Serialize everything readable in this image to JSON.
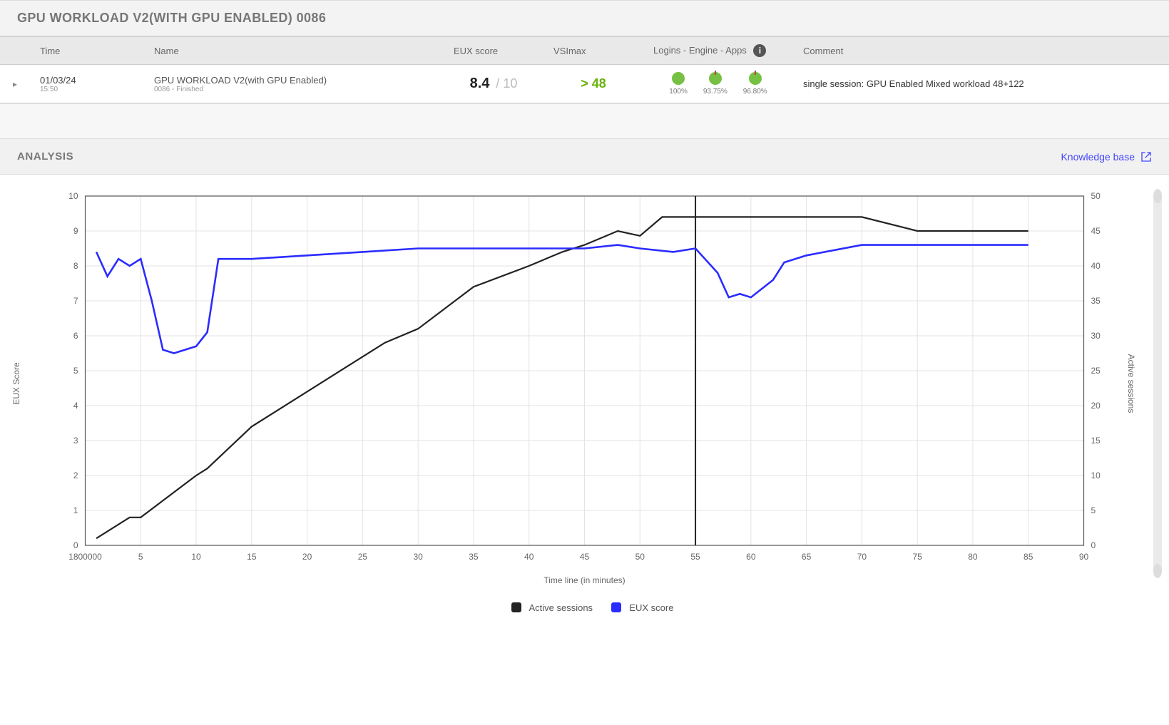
{
  "header": {
    "title": "GPU WORKLOAD V2(WITH GPU ENABLED) 0086"
  },
  "table": {
    "cols": {
      "time": "Time",
      "name": "Name",
      "eux": "EUX score",
      "vsi": "VSImax",
      "lea": "Logins - Engine - Apps",
      "comment": "Comment"
    },
    "row": {
      "date": "01/03/24",
      "time": "15:50",
      "run_name": "GPU WORKLOAD V2(with GPU Enabled)",
      "run_sub": "0086 - Finished",
      "eux_value": "8.4",
      "eux_max": " / 10",
      "vsimax": "> 48",
      "logins_pct": "100%",
      "engine_pct": "93.75%",
      "apps_pct": "96.80%",
      "comment": "single session: GPU Enabled Mixed workload 48+122"
    }
  },
  "analysis": {
    "title": "ANALYSIS",
    "kb_link": "Knowledge base"
  },
  "legend": {
    "sessions": "Active sessions",
    "eux": "EUX score"
  },
  "axes": {
    "left_label": "EUX Score",
    "right_label": "Active sessions",
    "x_label": "Time line (in minutes)",
    "x_first_tick": "1800000"
  },
  "chart_data": {
    "type": "line",
    "title": "",
    "xlabel": "Time line (in minutes)",
    "x_range": [
      0,
      90
    ],
    "x_ticks": [
      0,
      5,
      10,
      15,
      20,
      25,
      30,
      35,
      40,
      45,
      50,
      55,
      60,
      65,
      70,
      75,
      80,
      85,
      90
    ],
    "y_left": {
      "label": "EUX Score",
      "range": [
        0,
        10
      ],
      "ticks": [
        0,
        1,
        2,
        3,
        4,
        5,
        6,
        7,
        8,
        9,
        10
      ]
    },
    "y_right": {
      "label": "Active sessions",
      "range": [
        0,
        50
      ],
      "ticks": [
        0,
        5,
        10,
        15,
        20,
        25,
        30,
        35,
        40,
        45,
        50
      ]
    },
    "marker_x": 55,
    "series": [
      {
        "name": "Active sessions",
        "axis": "right",
        "color": "#222222",
        "x": [
          1,
          4,
          5,
          10,
          11,
          15,
          20,
          25,
          27,
          30,
          35,
          40,
          43,
          45,
          48,
          50,
          52,
          55,
          70,
          75,
          85
        ],
        "values": [
          1,
          4,
          4,
          10,
          11,
          17,
          22,
          27,
          29,
          31,
          37,
          40,
          42,
          43,
          45,
          44.3,
          47,
          47,
          47,
          45,
          45
        ]
      },
      {
        "name": "EUX score",
        "axis": "left",
        "color": "#2b2cff",
        "x": [
          1,
          2,
          3,
          4,
          5,
          6,
          7,
          8,
          9,
          10,
          11,
          12,
          15,
          20,
          25,
          30,
          40,
          45,
          48,
          50,
          53,
          55,
          57,
          58,
          59,
          60,
          62,
          63,
          65,
          70,
          85
        ],
        "values": [
          8.4,
          7.7,
          8.2,
          8.0,
          8.2,
          7.0,
          5.6,
          5.5,
          5.6,
          5.7,
          6.1,
          8.2,
          8.2,
          8.3,
          8.4,
          8.5,
          8.5,
          8.5,
          8.6,
          8.5,
          8.4,
          8.5,
          7.8,
          7.1,
          7.2,
          7.1,
          7.6,
          8.1,
          8.3,
          8.6,
          8.6
        ]
      }
    ]
  }
}
